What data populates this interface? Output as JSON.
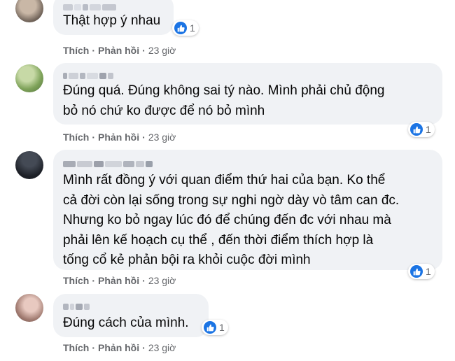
{
  "actions": {
    "like": "Thích",
    "reply": "Phản hồi",
    "separator": "·"
  },
  "comments": [
    {
      "text_lines": [
        "Thật hợp ý nhau"
      ],
      "reactions": "1",
      "time": "23 giờ"
    },
    {
      "text_lines": [
        "Đúng quá. Đúng không sai tý nào. Mình phải chủ động",
        "bỏ nó chứ ko được để nó bỏ mình"
      ],
      "reactions": "1",
      "time": "23 giờ"
    },
    {
      "text_lines": [
        "Mình rất đồng ý với quan điểm thứ hai của bạn. Ko thể",
        "cả đời còn lại sống trong sự nghi ngờ dày vò tâm can đc.",
        "Nhưng ko bỏ ngay lúc đó để chúng đến đc với nhau mà",
        "phải lên kế hoạch cụ thể , đến thời điểm thích hợp là",
        "tống cổ kẻ phản bội ra khỏi cuộc đời mình"
      ],
      "reactions": "1",
      "time": "23 giờ"
    },
    {
      "text_lines": [
        "Đúng cách của mình."
      ],
      "reactions": "1",
      "time": "23 giờ"
    }
  ],
  "colors": {
    "bubble": "#f0f2f5",
    "like_blue": "#1b74e4",
    "meta_gray": "#65676b"
  },
  "icons": {
    "reaction": "like-thumb-icon"
  }
}
